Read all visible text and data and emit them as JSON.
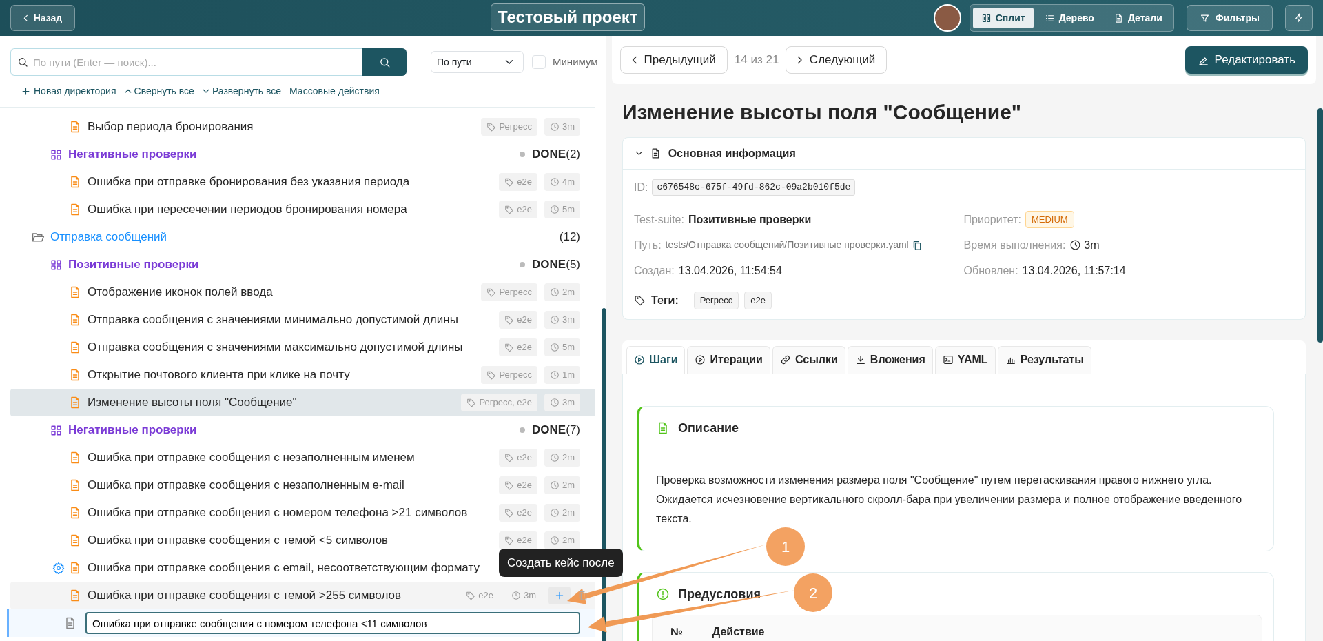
{
  "header": {
    "back": "Назад",
    "title": "Тестовый проект",
    "view_modes": [
      {
        "label": "Сплит",
        "selected": true
      },
      {
        "label": "Дерево",
        "selected": false
      },
      {
        "label": "Детали",
        "selected": false
      }
    ],
    "filters": "Фильтры"
  },
  "search": {
    "placeholder": "По пути (Enter — поиск)...",
    "sort": "По пути",
    "minimum": {
      "label": "Минимум",
      "checked": false
    }
  },
  "actions": [
    "Новая директория",
    "Свернуть все",
    "Развернуть все",
    "Массовые действия"
  ],
  "tree": [
    {
      "children": [
        {
          "children": [
            {
              "kind": "case",
              "label": "Выбор периода бронирования",
              "tags": "Регресс",
              "time": "3m",
              "selected": false
            }
          ]
        },
        {
          "kind": "suite",
          "label": "Негативные проверки",
          "status": "DONE",
          "count": "(2)",
          "children": [
            {
              "kind": "case",
              "label": "Ошибка при отправке бронирования без указания периода",
              "tags": "e2e",
              "time": "4m",
              "selected": false
            },
            {
              "kind": "case",
              "label": "Ошибка при пересечении периодов бронирования номера",
              "tags": "e2e",
              "time": "5m",
              "selected": false
            }
          ]
        }
      ]
    },
    {
      "kind": "dir",
      "label": "Отправка сообщений",
      "count": "(12)",
      "children": [
        {
          "kind": "suite",
          "label": "Позитивные проверки",
          "status": "DONE",
          "count": "(5)",
          "children": [
            {
              "kind": "case",
              "label": "Отображение иконок полей ввода",
              "tags": "Регресс",
              "time": "2m",
              "selected": false
            },
            {
              "kind": "case",
              "label": "Отправка сообщения с значениями минимально допустимой длины",
              "tags": "e2e",
              "time": "3m",
              "selected": false
            },
            {
              "kind": "case",
              "label": "Отправка сообщения с значениями максимально допустимой длины",
              "tags": "e2e",
              "time": "5m",
              "selected": false
            },
            {
              "kind": "case",
              "label": "Открытие почтового клиента при клике на почту",
              "tags": "Регресс",
              "time": "1m",
              "selected": false
            },
            {
              "kind": "case",
              "label": "Изменение высоты поля \"Сообщение\"",
              "tags": "Регресс, e2e",
              "time": "3m",
              "selected": true
            }
          ]
        },
        {
          "kind": "suite",
          "label": "Негативные проверки",
          "status": "DONE",
          "count": "(7)",
          "children": [
            {
              "kind": "case",
              "label": "Ошибка при отправке сообщения с незаполненным именем",
              "tags": "e2e",
              "time": "2m",
              "selected": false
            },
            {
              "kind": "case",
              "label": "Ошибка при отправке сообщения с незаполненным e-mail",
              "tags": "e2e",
              "time": "2m",
              "selected": false
            },
            {
              "kind": "case",
              "label": "Ошибка при отправке сообщения с номером телефона >21 символов",
              "tags": "e2e",
              "time": "2m",
              "selected": false
            },
            {
              "kind": "case",
              "label": "Ошибка при отправке сообщения с темой <5 символов",
              "tags": "e2e",
              "time": "2m",
              "selected": false
            },
            {
              "kind": "case",
              "label": "Ошибка при отправке сообщения с email, несоответствующим формату",
              "automated": true,
              "selected": false
            },
            {
              "kind": "case",
              "label": "Ошибка при отправке сообщения с темой >255 символов",
              "tags": "e2e",
              "time": "3m",
              "hovered": true,
              "tooltip": "Создать кейс после",
              "selected": false
            },
            {
              "kind": "new",
              "value": "Ошибка при отправке сообщения с номером телефона <11 символов"
            }
          ]
        }
      ]
    }
  ],
  "nav": {
    "prev": "Предыдущий",
    "counter": "14 из 21",
    "next": "Следующий",
    "edit": "Редактировать"
  },
  "title": "Изменение высоты поля \"Сообщение\"",
  "info": {
    "heading": "Основная информация",
    "expanded": true,
    "id": {
      "label": "ID:",
      "value": "c676548c-675f-49fd-862c-09a2b010f5de"
    },
    "fields": [
      {
        "label": "Test-suite:",
        "value": "Позитивные проверки",
        "kind": "bold"
      },
      {
        "label": "Приоритет:",
        "value": "MEDIUM",
        "kind": "badge"
      },
      {
        "label": "Путь:",
        "value": "tests/Отправка сообщений/Позитивные проверки.yaml",
        "kind": "path"
      },
      {
        "label": "Время выполнения:",
        "value": "3m",
        "kind": "time"
      },
      {
        "label": "Создан:",
        "value": "13.04.2026, 11:54:54",
        "kind": "plain"
      },
      {
        "label": "Обновлен:",
        "value": "13.04.2026, 11:57:14",
        "kind": "plain"
      }
    ],
    "tags_label": "Теги:",
    "tags": [
      "Регресс",
      "e2e"
    ]
  },
  "tabs": [
    {
      "label": "Шаги",
      "selected": true
    },
    {
      "label": "Итерации",
      "selected": false
    },
    {
      "label": "Ссылки",
      "selected": false
    },
    {
      "label": "Вложения",
      "selected": false
    },
    {
      "label": "YAML",
      "selected": false
    },
    {
      "label": "Результаты",
      "selected": false
    }
  ],
  "sections": [
    {
      "kind": "text",
      "heading": "Описание",
      "text": "Проверка возможности изменения размера поля \"Сообщение\" путем перетаскивания правого нижнего угла. Ожидается исчезновение вертикального скролл-бара при увеличении размера и полное отображение введенного текста."
    },
    {
      "kind": "table",
      "heading": "Предусловия",
      "columns": [
        "№",
        "Действие"
      ]
    }
  ],
  "annotations": [
    {
      "label": "1"
    },
    {
      "label": "2"
    }
  ]
}
